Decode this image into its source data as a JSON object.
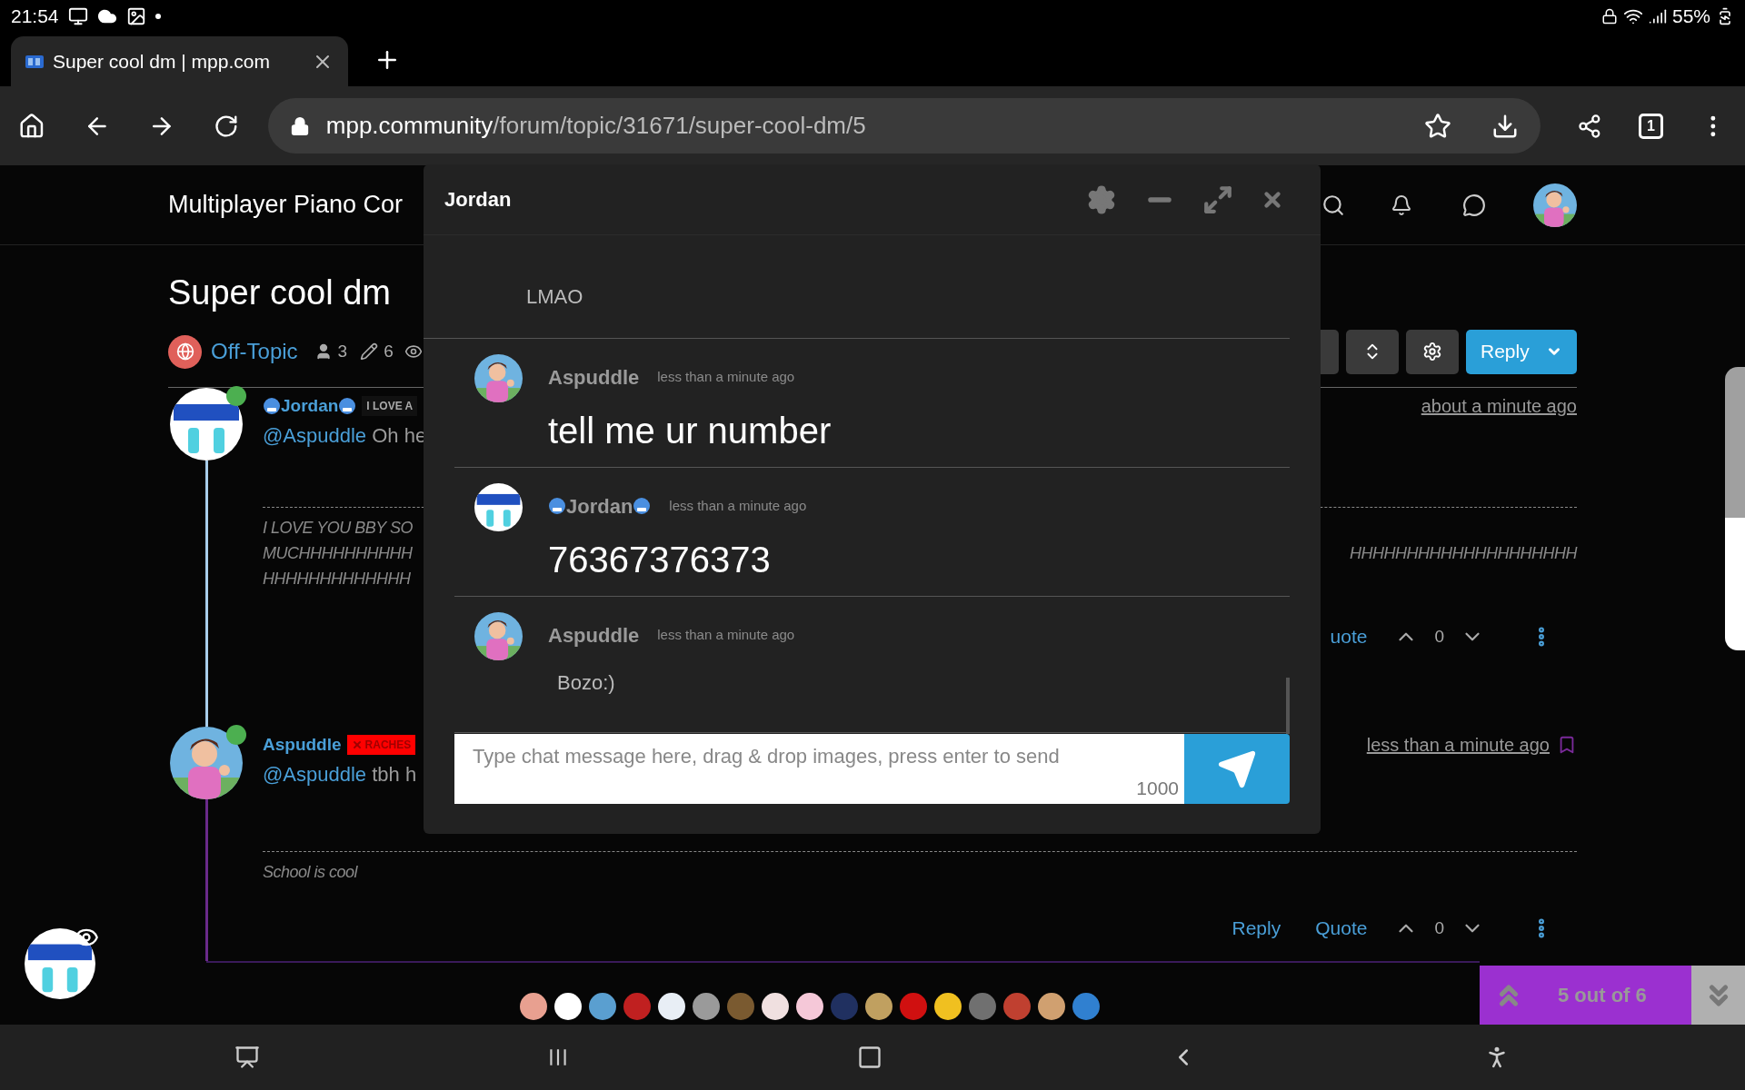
{
  "status_bar": {
    "time": "21:54",
    "battery": "55%"
  },
  "browser": {
    "tabs": [
      {
        "title": "Super cool dm | mpp.com",
        "selected": true
      }
    ],
    "url_host": "mpp.community",
    "url_path": "/forum/topic/31671/super-cool-dm/5",
    "tab_count": "1"
  },
  "site": {
    "title": "Multiplayer Piano Cor"
  },
  "topic": {
    "title": "Super cool dm",
    "category": "Off-Topic",
    "posters": "3",
    "posts": "6",
    "reply_button": "Reply"
  },
  "posts": [
    {
      "author": "Jordan",
      "name_icons": true,
      "badge": {
        "label": "I LOVE A",
        "color": "#111111",
        "icon": false
      },
      "online": true,
      "mention": "@Aspuddle",
      "text": "Oh he",
      "time": "about a minute ago",
      "quote_lines": [
        {
          "left": "I LOVE YOU BBY SO"
        },
        {
          "left": "MUCHHHHHHHHHH",
          "right": "HHHHHHHHHHHHHHHHHHHH"
        },
        {
          "left": "HHHHHHHHHHHHH"
        }
      ],
      "actions": [
        "uote"
      ],
      "votes": "0"
    },
    {
      "author": "Aspuddle",
      "name_icons": false,
      "badge": {
        "label": "RACHES",
        "color": "#ff0000",
        "icon": true
      },
      "online": true,
      "mention": "@Aspuddle",
      "text": "tbh h",
      "time": "less than a minute ago",
      "bookmark": true,
      "quote_lines": [
        {
          "left": "School is cool"
        }
      ],
      "actions": [
        "Reply",
        "Quote"
      ],
      "votes": "0"
    }
  ],
  "chat": {
    "title": "Jordan",
    "messages": [
      {
        "text": "LMAO",
        "kind": "plain"
      },
      {
        "author": "Aspuddle",
        "name_icons": false,
        "time": "less than a minute ago",
        "text": "tell me ur number",
        "kind": "large"
      },
      {
        "author": "Jordan",
        "name_icons": true,
        "time": "less than a minute ago",
        "text": "76367376373",
        "kind": "large"
      },
      {
        "author": "Aspuddle",
        "name_icons": false,
        "time": "less than a minute ago",
        "text": "Bozo:)",
        "kind": "plain"
      }
    ],
    "input_placeholder": "Type chat message here, drag & drop images, press enter to send",
    "char_limit": "1000"
  },
  "participants": [
    {
      "color": "#e8a090"
    },
    {
      "color": "#ffffff"
    },
    {
      "color": "#5a9fd0"
    },
    {
      "color": "#c02020"
    },
    {
      "color": "#e8eef5"
    },
    {
      "color": "#9a9a9a"
    },
    {
      "color": "#7a5a30"
    },
    {
      "color": "#f0e0e0"
    },
    {
      "color": "#f5c8d8"
    },
    {
      "color": "#203060"
    },
    {
      "color": "#c0a060"
    },
    {
      "color": "#d01010"
    },
    {
      "color": "#f0c020"
    },
    {
      "color": "#707070"
    },
    {
      "color": "#c04030"
    },
    {
      "color": "#d0a070"
    },
    {
      "color": "#3080d0"
    }
  ],
  "pagination": {
    "label": "5 out of 6"
  }
}
